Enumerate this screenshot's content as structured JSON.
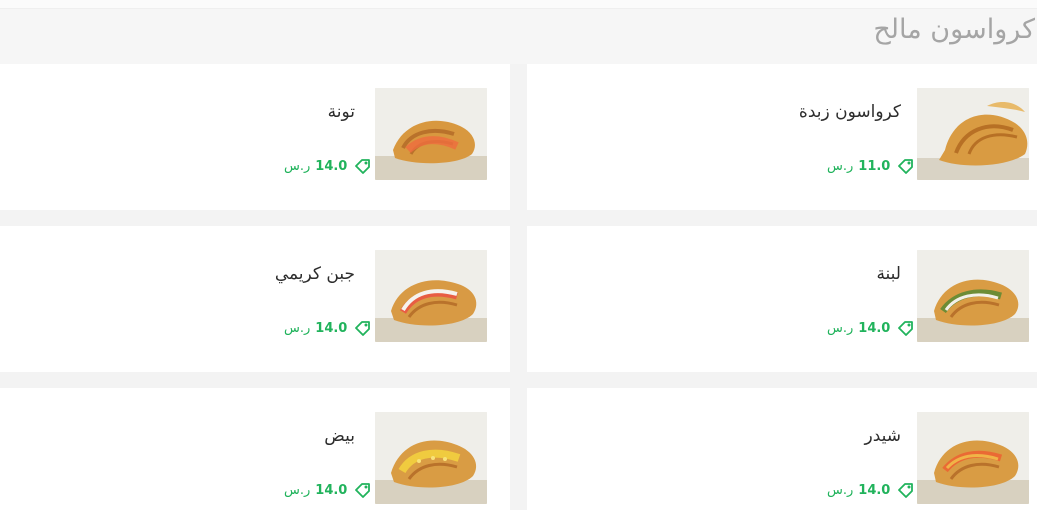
{
  "section": {
    "title": "كرواسون مالح"
  },
  "items": [
    {
      "name": "تونة",
      "price": "14.0",
      "currency": "ر.س",
      "icon": "tag-icon"
    },
    {
      "name": "كرواسون زبدة",
      "price": "11.0",
      "currency": "ر.س",
      "icon": "tag-icon"
    },
    {
      "name": "جبن كريمي",
      "price": "14.0",
      "currency": "ر.س",
      "icon": "tag-icon"
    },
    {
      "name": "لبنة",
      "price": "14.0",
      "currency": "ر.س",
      "icon": "tag-icon"
    },
    {
      "name": "بيض",
      "price": "14.0",
      "currency": "ر.س",
      "icon": "tag-icon"
    },
    {
      "name": "شيدر",
      "price": "14.0",
      "currency": "ر.س",
      "icon": "tag-icon"
    }
  ],
  "colors": {
    "accent": "#21b35c",
    "title": "#a5a5a5",
    "name": "#2d2d2d"
  }
}
